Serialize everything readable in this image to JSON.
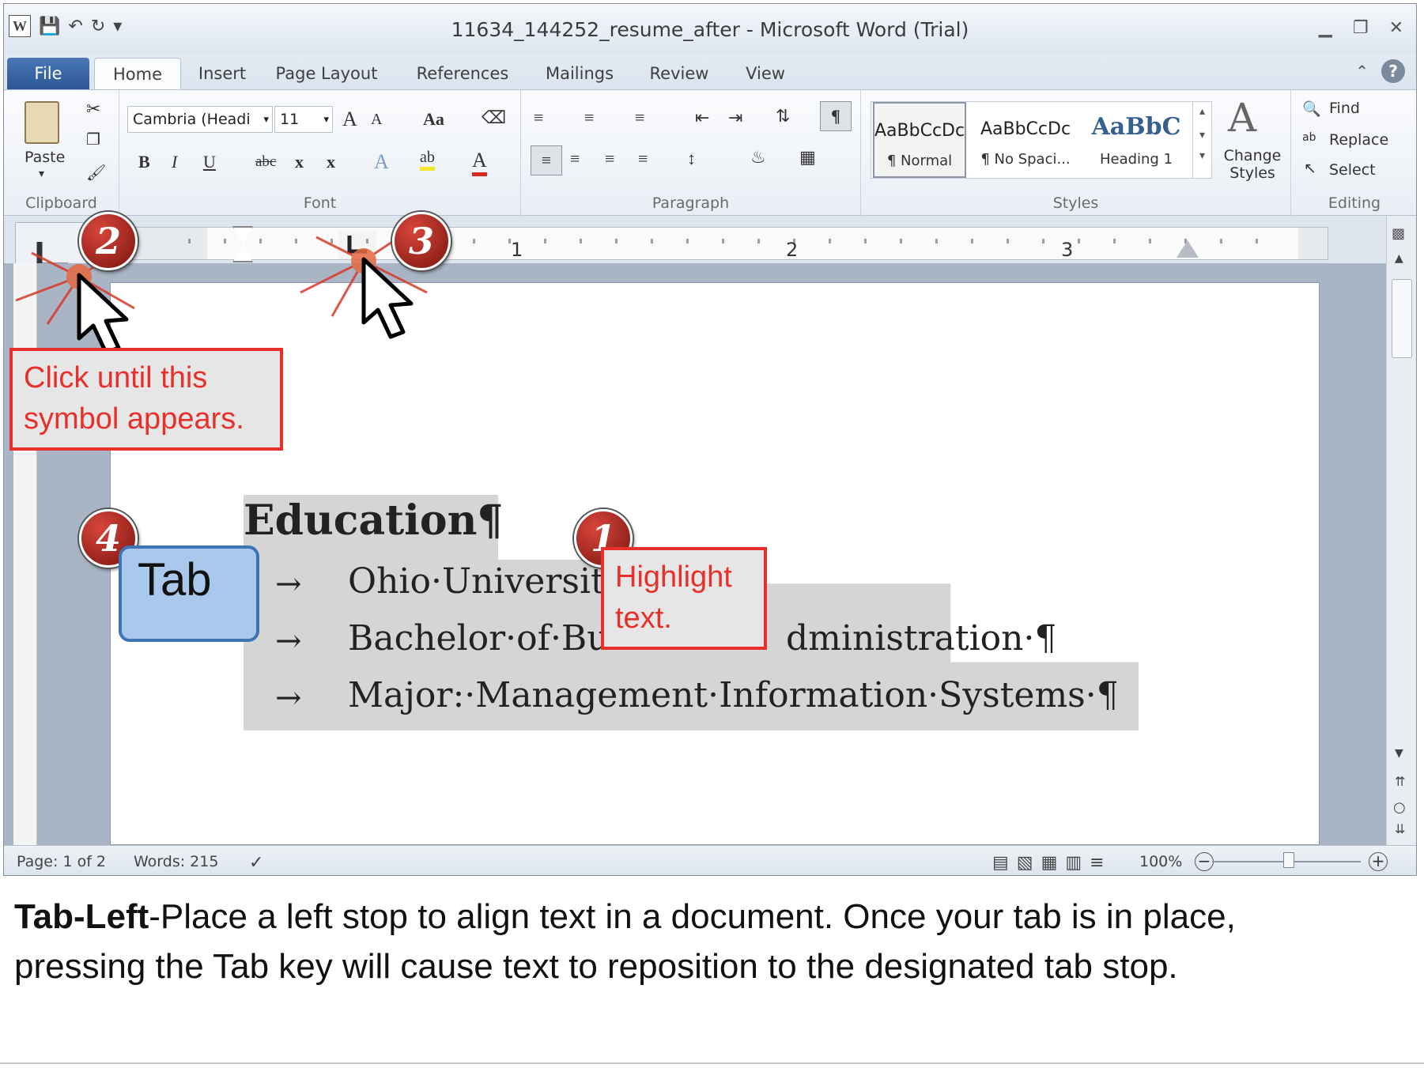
{
  "window": {
    "title": "11634_144252_resume_after  -  Microsoft Word (Trial)",
    "app_icon": "W"
  },
  "tabs": [
    "File",
    "Home",
    "Insert",
    "Page Layout",
    "References",
    "Mailings",
    "Review",
    "View"
  ],
  "ribbon": {
    "clipboard": {
      "paste_label": "Paste",
      "group_label": "Clipboard"
    },
    "font": {
      "font_name": "Cambria (Headi",
      "font_size": "11",
      "grow": "A",
      "shrink": "A",
      "change_case": "Aa",
      "bold": "B",
      "italic": "I",
      "underline": "U",
      "strike": "abc",
      "subscript": "x",
      "superscript": "x",
      "group_label": "Font"
    },
    "paragraph": {
      "show_hide": "¶",
      "group_label": "Paragraph"
    },
    "styles": {
      "items": [
        {
          "preview": "AaBbCcDc",
          "name": "¶ Normal"
        },
        {
          "preview": "AaBbCcDc",
          "name": "¶ No Spaci..."
        },
        {
          "preview": "AaBbC",
          "name": "Heading 1"
        }
      ],
      "change_styles": "Change Styles",
      "group_label": "Styles"
    },
    "editing": {
      "find": "Find",
      "replace": "Replace",
      "select": "Select",
      "group_label": "Editing"
    }
  },
  "ruler": {
    "numbers": [
      "1",
      "2",
      "3"
    ]
  },
  "document": {
    "heading": "Education¶",
    "lines": [
      "Ohio·Universit",
      "Bachelor·of·Bu",
      "Major:·Management·Information·Systems·¶"
    ],
    "line2_tail": "dministration·¶",
    "tab_arrow": "→"
  },
  "status": {
    "page": "Page: 1 of 2",
    "words": "Words: 215",
    "zoom": "100%",
    "zoom_level": 1.0
  },
  "annotations": {
    "step1": "1",
    "step2": "2",
    "step3": "3",
    "step4": "4",
    "callout_click": [
      "Click until this",
      "symbol appears."
    ],
    "callout_highlight": [
      "Highlight",
      "text."
    ],
    "tab_key_label": "Tab"
  },
  "caption": {
    "bold": "Tab-Left",
    "line1_rest": "-Place a left stop to align text in a document. Once your tab is in place,",
    "line2": "pressing the Tab key will cause text to reposition to the designated tab stop."
  },
  "colors": {
    "callout_red": "#e8302b",
    "file_tab_blue": "#2b5797",
    "tab_key_blue": "#a9c8ec"
  }
}
